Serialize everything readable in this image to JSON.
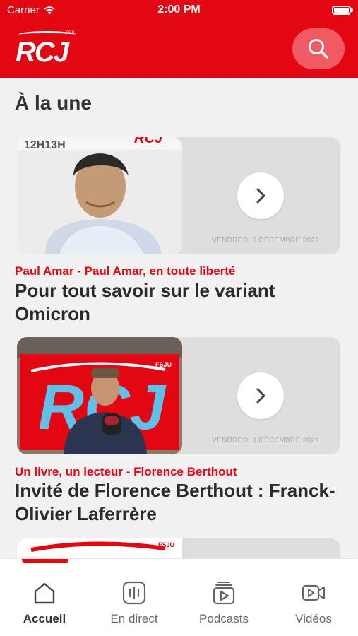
{
  "status": {
    "carrier": "Carrier",
    "time": "2:00 PM"
  },
  "header": {
    "logo_text": "RCJ",
    "logo_small": "FSJU"
  },
  "section": {
    "title": "À la une"
  },
  "articles": [
    {
      "thumb_badge": "12H13H",
      "thumb_brand": "RCJ",
      "date": "VENDREDI 3 DÉCEMBRE 2021",
      "show": "Paul Amar - Paul Amar, en toute liberté",
      "title": "Pour tout savoir sur le variant Omicron"
    },
    {
      "thumb_brand": "RCJ",
      "thumb_small": "FSJU",
      "date": "VENDREDI 3 DÉCEMBRE 2021",
      "show": "Un livre, un lecteur - Florence Berthout",
      "title": "Invité de Florence Berthout : Franck-Olivier Laferrère"
    },
    {
      "thumb_small": "FSJU"
    }
  ],
  "tabs": [
    {
      "label": "Accueil",
      "icon": "home-icon",
      "active": true
    },
    {
      "label": "En direct",
      "icon": "live-radio-icon"
    },
    {
      "label": "Podcasts",
      "icon": "podcast-icon"
    },
    {
      "label": "Vidéos",
      "icon": "video-icon"
    }
  ],
  "colors": {
    "brand_red": "#e30613",
    "search_bg": "#ef5a63",
    "card_bg": "#dedede",
    "page_bg": "#f1f1f1"
  }
}
